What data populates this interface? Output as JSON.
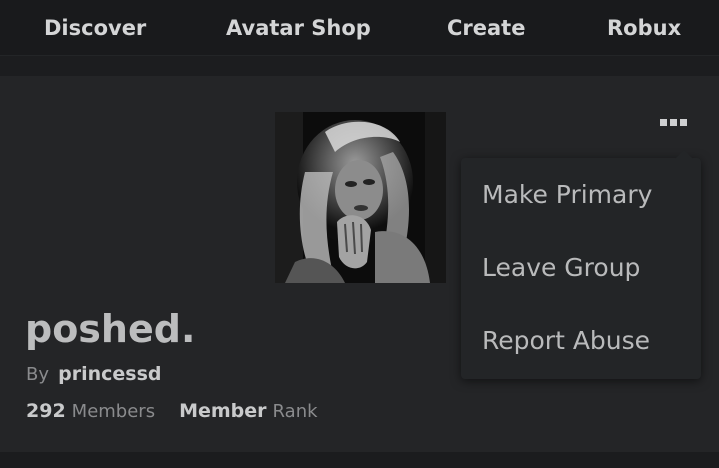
{
  "nav": {
    "items": [
      {
        "label": "Discover"
      },
      {
        "label": "Avatar Shop"
      },
      {
        "label": "Create"
      },
      {
        "label": "Robux"
      }
    ]
  },
  "group": {
    "name": "poshed.",
    "by_label": "By",
    "owner": "princessd",
    "members_count": "292",
    "members_label": "Members",
    "rank_value": "Member",
    "rank_label": "Rank",
    "emblem_icon": "group-emblem-image"
  },
  "menu": {
    "trigger_icon": "more-options-icon",
    "items": [
      {
        "label": "Make Primary"
      },
      {
        "label": "Leave Group"
      },
      {
        "label": "Report Abuse"
      }
    ]
  },
  "colors": {
    "page_bg": "#191a1c",
    "card_bg": "#242527",
    "menu_bg": "#232527"
  }
}
